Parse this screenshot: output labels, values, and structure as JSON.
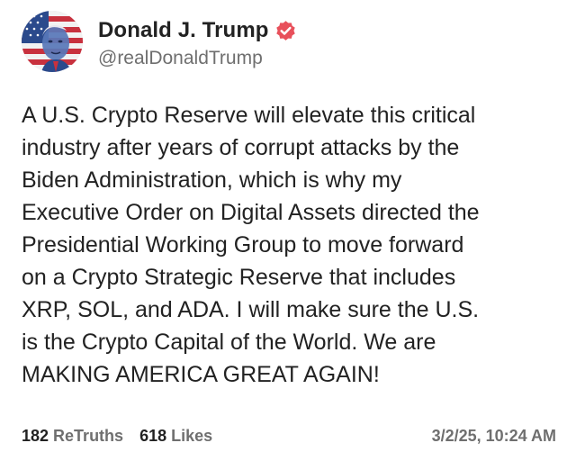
{
  "post": {
    "author": {
      "display_name": "Donald J. Trump",
      "handle": "@realDonaldTrump",
      "verified": true,
      "verified_badge_color": "#e8505b",
      "avatar_icon": "profile-avatar-flag-portrait"
    },
    "body_lines": [
      "A U.S. Crypto Reserve will elevate this critical",
      "industry after years of corrupt attacks by the",
      "Biden Administration, which is why my",
      "Executive Order on Digital Assets directed the",
      "Presidential Working Group to move forward",
      "on a Crypto Strategic Reserve that includes",
      "XRP, SOL, and ADA. I will make sure the U.S.",
      "is the Crypto Capital of the World. We are",
      "MAKING AMERICA GREAT AGAIN!"
    ],
    "stats": {
      "retruths_count": "182",
      "retruths_label": "ReTruths",
      "likes_count": "618",
      "likes_label": "Likes"
    },
    "timestamp": "3/2/25, 10:24 AM"
  }
}
